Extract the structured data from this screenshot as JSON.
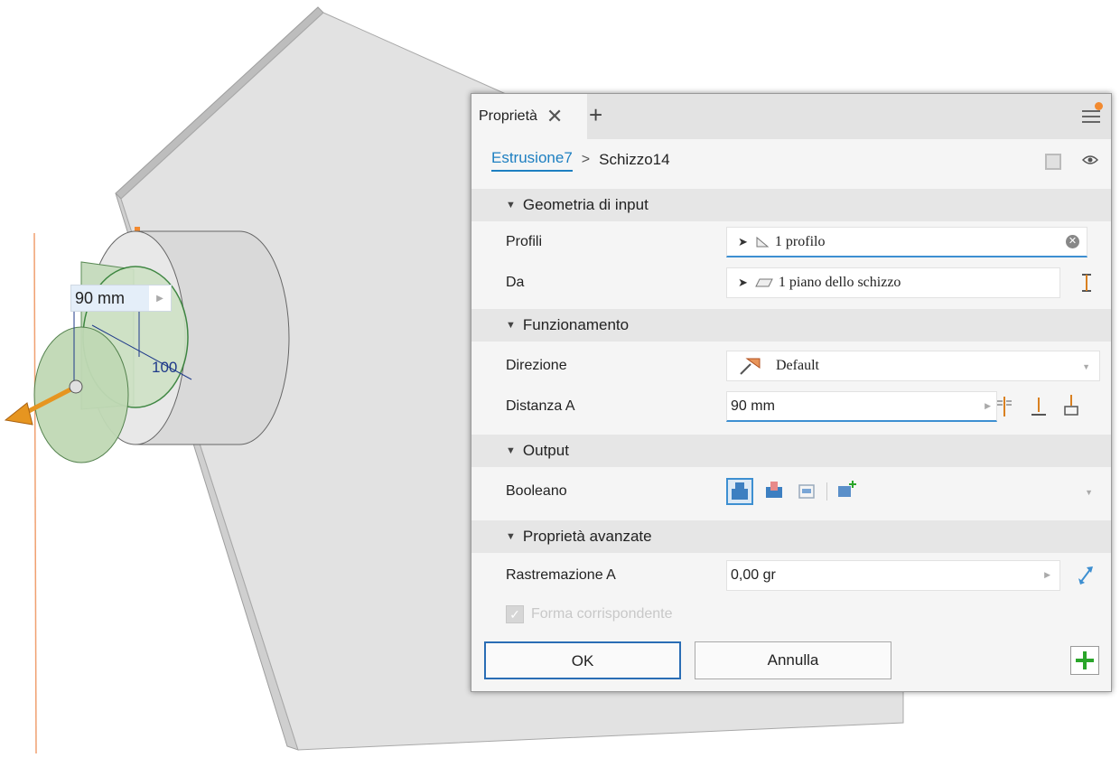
{
  "viewport": {
    "dimension_value": "90 mm",
    "dimension_label": "100"
  },
  "panel": {
    "tab_label": "Proprietà",
    "breadcrumb": {
      "active": "Estrusione7",
      "next": "Schizzo14"
    },
    "sections": {
      "input_geometry": "Geometria di input",
      "behavior": "Funzionamento",
      "output": "Output",
      "advanced": "Proprietà avanzate"
    },
    "fields": {
      "profiles": {
        "label": "Profili",
        "value": "1 profilo"
      },
      "from": {
        "label": "Da",
        "value": "1 piano dello schizzo"
      },
      "direction": {
        "label": "Direzione",
        "value": "Default"
      },
      "distance": {
        "label": "Distanza A",
        "value": "90 mm"
      },
      "boolean": {
        "label": "Booleano"
      },
      "taper": {
        "label": "Rastremazione A",
        "value": "0,00 gr"
      },
      "match_shape": {
        "label": "Forma corrispondente",
        "checked": true,
        "enabled": false
      }
    },
    "buttons": {
      "ok": "OK",
      "cancel": "Annulla"
    }
  },
  "colors": {
    "accent": "#1d7fc1",
    "notify": "#f28a30",
    "add_green": "#2aa52a",
    "preview_green": "#b7d7a8"
  }
}
